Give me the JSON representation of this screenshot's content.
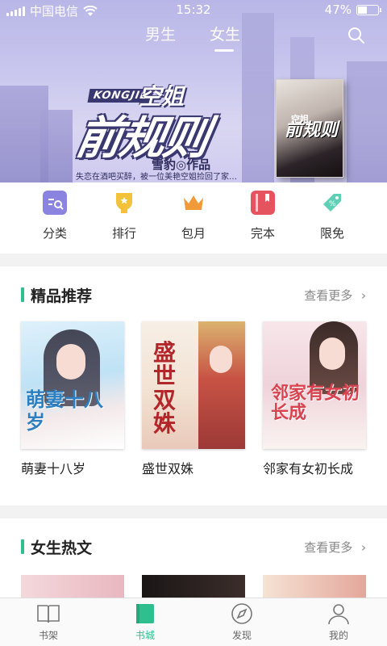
{
  "status_bar": {
    "carrier": "中国电信",
    "time": "15:32",
    "battery": "47%",
    "battery_level": 0.47
  },
  "gender_tabs": [
    {
      "label": "男生",
      "active": false
    },
    {
      "label": "女生",
      "active": true
    }
  ],
  "banner": {
    "logo_small": "空姐",
    "logo_big": "前规则",
    "logo_en": "KONGJIE",
    "author": "雪豹◎作品",
    "desc": "失恋在酒吧买醉，被一位美艳空姐捡回了家…",
    "book_title_small": "空姐",
    "book_title_big": "前规则"
  },
  "categories": [
    {
      "label": "分类",
      "icon": "category-icon",
      "color": "#7b74d9"
    },
    {
      "label": "排行",
      "icon": "ranking-icon",
      "color": "#f2c23a"
    },
    {
      "label": "包月",
      "icon": "crown-icon",
      "color": "#f19a3a"
    },
    {
      "label": "完本",
      "icon": "book-icon",
      "color": "#e5545e"
    },
    {
      "label": "限免",
      "icon": "tag-icon",
      "color": "#5fd0b6"
    }
  ],
  "sections": [
    {
      "title": "精品推荐",
      "more": "查看更多",
      "books": [
        {
          "name": "萌妻十八岁",
          "cover_text": "萌妻十八岁"
        },
        {
          "name": "盛世双姝",
          "cover_text": "盛世双姝"
        },
        {
          "name": "邻家有女初长成",
          "cover_text": "邻家有女初长成"
        }
      ]
    },
    {
      "title": "女生热文",
      "more": "查看更多"
    }
  ],
  "tabbar": [
    {
      "label": "书架",
      "icon": "bookshelf-icon",
      "active": false
    },
    {
      "label": "书城",
      "icon": "bookstore-icon",
      "active": true
    },
    {
      "label": "发现",
      "icon": "compass-icon",
      "active": false
    },
    {
      "label": "我的",
      "icon": "user-icon",
      "active": false
    }
  ],
  "colors": {
    "accent": "#2fbe8e"
  }
}
